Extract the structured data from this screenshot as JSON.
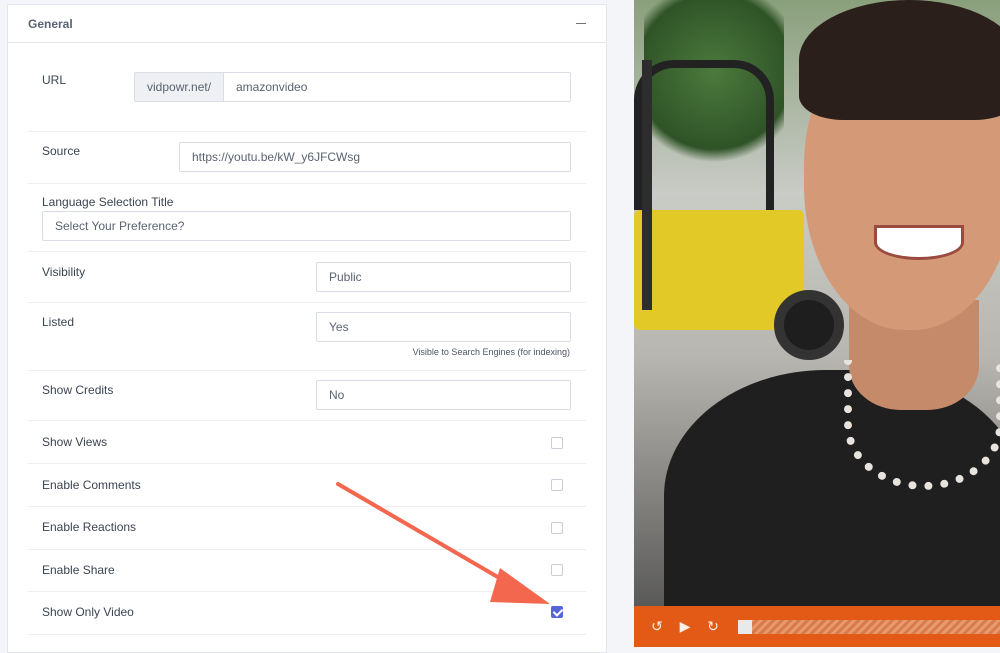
{
  "panel": {
    "title": "General"
  },
  "url": {
    "label": "URL",
    "prefix": "vidpowr.net/",
    "value": "amazonvideo"
  },
  "source": {
    "label": "Source",
    "value": "https://youtu.be/kW_y6JFCWsg"
  },
  "language": {
    "label": "Language Selection Title",
    "placeholder": "Select Your Preference?"
  },
  "visibility": {
    "label": "Visibility",
    "value": "Public"
  },
  "listed": {
    "label": "Listed",
    "value": "Yes",
    "help": "Visible to Search Engines (for indexing)"
  },
  "credits": {
    "label": "Show Credits",
    "value": "No"
  },
  "toggles": [
    {
      "label": "Show Views",
      "checked": false
    },
    {
      "label": "Enable Comments",
      "checked": false
    },
    {
      "label": "Enable Reactions",
      "checked": false
    },
    {
      "label": "Enable Share",
      "checked": false
    },
    {
      "label": "Show Only Video",
      "checked": true
    }
  ],
  "player": {
    "rewind_icon": "rewind-10-icon",
    "play_icon": "play-icon",
    "forward_icon": "forward-10-icon",
    "progress": 0
  },
  "colors": {
    "accent": "#5865d6",
    "player": "#e35a16",
    "annotation_arrow": "#f2674d"
  }
}
